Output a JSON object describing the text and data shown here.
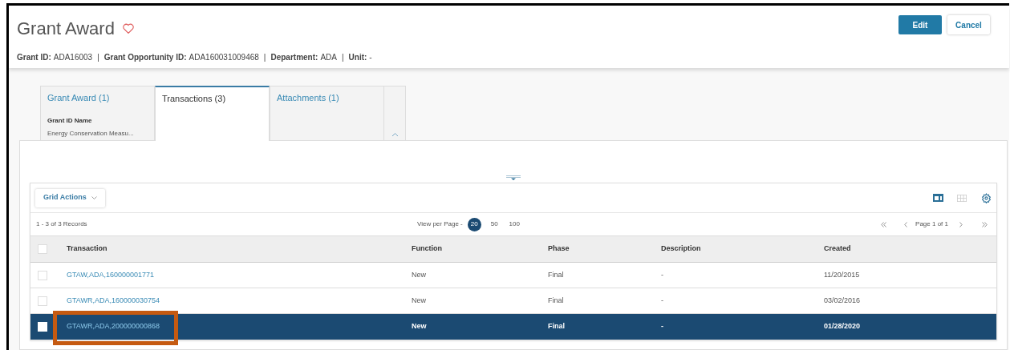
{
  "header": {
    "title": "Grant Award",
    "favorite": false,
    "meta": [
      {
        "label": "Grant ID:",
        "value": "ADA16003"
      },
      {
        "label": "Grant Opportunity ID:",
        "value": "ADA160031009468"
      },
      {
        "label": "Department:",
        "value": "ADA"
      },
      {
        "label": "Unit:",
        "value": "-"
      }
    ],
    "separator": "|",
    "buttons": [
      {
        "label": "Edit",
        "kind": "primary"
      },
      {
        "label": "Cancel",
        "kind": "secondary"
      }
    ]
  },
  "tabs": [
    {
      "label": "Grant Award (1)",
      "selected": false,
      "field_label": "Grant ID Name",
      "field_value": "Energy Conservation Measu..."
    },
    {
      "label": "Transactions (3)",
      "selected": true
    },
    {
      "label": "Attachments (1)",
      "selected": false
    }
  ],
  "grid": {
    "actions_label": "Grid Actions",
    "records": "1 - 3 of 3 Records",
    "view_per_page_label": "View per Page -",
    "page_sizes": [
      {
        "label": "20",
        "selected": true
      },
      {
        "label": "50",
        "selected": false
      },
      {
        "label": "100",
        "selected": false
      }
    ],
    "page_info": "Page 1 of 1",
    "select_all_checked": false,
    "columns": [
      "Transaction",
      "Function",
      "Phase",
      "Description",
      "Created"
    ],
    "rows": [
      {
        "cells": [
          "GTAW,ADA,160000001771",
          "New",
          "Final",
          "-",
          "11/20/2015"
        ],
        "checked": false,
        "selected": false,
        "highlighted": false
      },
      {
        "cells": [
          "GTAWR,ADA,160000030754",
          "New",
          "Final",
          "-",
          "03/02/2016"
        ],
        "checked": false,
        "selected": false,
        "highlighted": false
      },
      {
        "cells": [
          "GTAWR,ADA,200000000868",
          "New",
          "Final",
          "-",
          "01/28/2020"
        ],
        "checked": false,
        "selected": true,
        "highlighted": true
      }
    ]
  }
}
